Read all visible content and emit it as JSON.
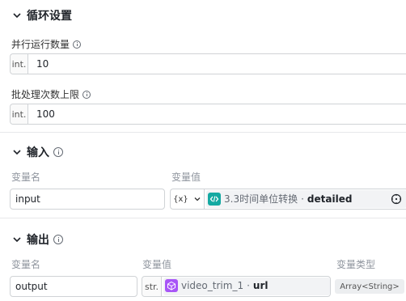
{
  "loop_settings": {
    "title": "循环设置",
    "parallel_label": "并行运行数量",
    "parallel_type": "int.",
    "parallel_value": "10",
    "batch_label": "批处理次数上限",
    "batch_type": "int.",
    "batch_value": "100"
  },
  "inputs": {
    "title": "输入",
    "col_name": "变量名",
    "col_value": "变量值",
    "rows": [
      {
        "name": "input",
        "value_type_symbol": "{x}",
        "ref_node": "3.3时间单位转换",
        "ref_separator": "·",
        "ref_field": "detailed"
      }
    ]
  },
  "outputs": {
    "title": "输出",
    "col_name": "变量名",
    "col_value": "变量值",
    "col_type": "变量类型",
    "rows": [
      {
        "name": "output",
        "value_type": "str.",
        "ref_node": "video_trim_1",
        "ref_separator": "·",
        "ref_field": "url",
        "var_type": "Array<String>"
      }
    ]
  },
  "colors": {
    "teal_icon": "#14a9a2",
    "purple_icon": "#a855f7",
    "border": "#d0d3d6",
    "divider": "#e7e8ea",
    "muted": "#8f959e"
  }
}
